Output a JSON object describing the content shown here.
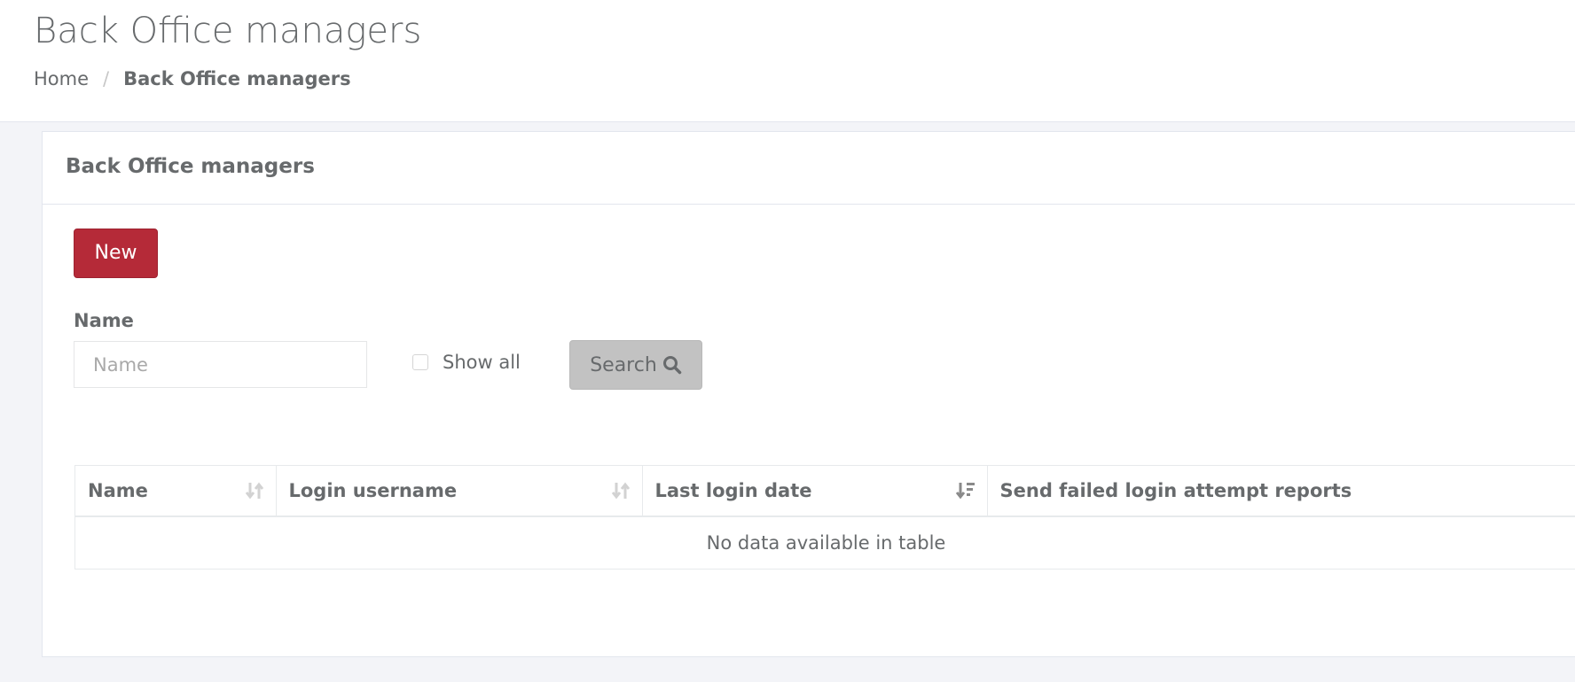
{
  "header": {
    "title": "Back Office managers",
    "breadcrumb": {
      "home": "Home",
      "separator": "/",
      "current": "Back Office managers"
    }
  },
  "panel": {
    "title": "Back Office managers",
    "new_button": "New",
    "filter": {
      "name_label": "Name",
      "name_placeholder": "Name",
      "name_value": "",
      "show_all_label": "Show all",
      "show_all_checked": false,
      "search_button": "Search",
      "search_icon": "search-icon"
    },
    "table": {
      "columns": [
        {
          "label": "Name",
          "sort": "both",
          "sort_icon": "sort-both-icon"
        },
        {
          "label": "Login username",
          "sort": "both",
          "sort_icon": "sort-both-icon"
        },
        {
          "label": "Last login date",
          "sort": "desc",
          "sort_icon": "sort-desc-icon"
        },
        {
          "label": "Send failed login attempt reports",
          "sort": "none"
        }
      ],
      "empty_message": "No data available in table"
    }
  },
  "colors": {
    "accent_red": "#b52a38",
    "search_button_bg": "#c2c2c2",
    "text": "#676a6c",
    "page_bg": "#f3f4f8"
  }
}
